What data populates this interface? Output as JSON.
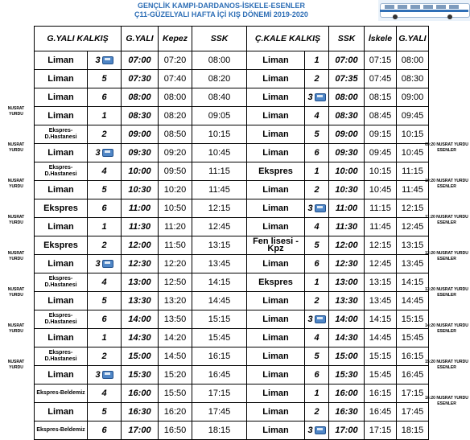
{
  "title": {
    "line1": "GENÇLİK KAMPI-DARDANOS-İSKELE-ESENLER",
    "line2": "Ç11-GÜZELYALI HAFTA İÇİ KIŞ DÖNEMİ 2019-2020"
  },
  "headers": [
    "G.YALI KALKIŞ",
    "",
    "G.YALI",
    "Kepez",
    "SSK",
    "Ç.KALE KALKIŞ",
    "",
    "SSK",
    "İskele",
    "G.YALI"
  ],
  "rows": [
    {
      "p1": "Liman",
      "n1": "3",
      "b1": true,
      "d1": "07:00",
      "k": "07:20",
      "s1": "08:00",
      "p2": "Liman",
      "n2": "1",
      "b2": false,
      "d2": "07:00",
      "s2": "07:15",
      "i": "08:00"
    },
    {
      "p1": "Liman",
      "n1": "5",
      "b1": false,
      "d1": "07:30",
      "k": "07:40",
      "s1": "08:20",
      "p2": "Liman",
      "n2": "2",
      "b2": false,
      "d2": "07:35",
      "s2": "07:45",
      "i": "08:30"
    },
    {
      "p1": "Liman",
      "n1": "6",
      "b1": false,
      "d1": "08:00",
      "k": "08:00",
      "s1": "08:40",
      "p2": "Liman",
      "n2": "3",
      "b2": true,
      "d2": "08:00",
      "s2": "08:15",
      "i": "09:00"
    },
    {
      "p1": "Liman",
      "n1": "1",
      "b1": false,
      "d1": "08:30",
      "k": "08:20",
      "s1": "09:05",
      "p2": "Liman",
      "n2": "4",
      "b2": false,
      "d2": "08:30",
      "s2": "08:45",
      "i": "09:45"
    },
    {
      "p1": "Ekspres-D.Hastanesi",
      "n1": "2",
      "b1": false,
      "d1": "09:00",
      "k": "08:50",
      "s1": "10:15",
      "p2": "Liman",
      "n2": "5",
      "b2": false,
      "d2": "09:00",
      "s2": "09:15",
      "i": "10:15"
    },
    {
      "p1": "Liman",
      "n1": "3",
      "b1": true,
      "d1": "09:30",
      "k": "09:20",
      "s1": "10:45",
      "p2": "Liman",
      "n2": "6",
      "b2": false,
      "d2": "09:30",
      "s2": "09:45",
      "i": "10:45"
    },
    {
      "p1": "Ekspres-D.Hastanesi",
      "n1": "4",
      "b1": false,
      "d1": "10:00",
      "k": "09:50",
      "s1": "11:15",
      "p2": "Ekspres",
      "n2": "1",
      "b2": false,
      "d2": "10:00",
      "s2": "10:15",
      "i": "11:15"
    },
    {
      "p1": "Liman",
      "n1": "5",
      "b1": false,
      "d1": "10:30",
      "k": "10:20",
      "s1": "11:45",
      "p2": "Liman",
      "n2": "2",
      "b2": false,
      "d2": "10:30",
      "s2": "10:45",
      "i": "11:45"
    },
    {
      "p1": "Ekspres",
      "n1": "6",
      "b1": false,
      "d1": "11:00",
      "k": "10:50",
      "s1": "12:15",
      "p2": "Liman",
      "n2": "3",
      "b2": true,
      "d2": "11:00",
      "s2": "11:15",
      "i": "12:15"
    },
    {
      "p1": "Liman",
      "n1": "1",
      "b1": false,
      "d1": "11:30",
      "k": "11:20",
      "s1": "12:45",
      "p2": "Liman",
      "n2": "4",
      "b2": false,
      "d2": "11:30",
      "s2": "11:45",
      "i": "12:45"
    },
    {
      "p1": "Ekspres",
      "n1": "2",
      "b1": false,
      "d1": "12:00",
      "k": "11:50",
      "s1": "13:15",
      "p2": "Fen lisesi - Kpz",
      "n2": "5",
      "b2": false,
      "d2": "12:00",
      "s2": "12:15",
      "i": "13:15"
    },
    {
      "p1": "Liman",
      "n1": "3",
      "b1": true,
      "d1": "12:30",
      "k": "12:20",
      "s1": "13:45",
      "p2": "Liman",
      "n2": "6",
      "b2": false,
      "d2": "12:30",
      "s2": "12:45",
      "i": "13:45"
    },
    {
      "p1": "Ekspres-D.Hastanesi",
      "n1": "4",
      "b1": false,
      "d1": "13:00",
      "k": "12:50",
      "s1": "14:15",
      "p2": "Ekspres",
      "n2": "1",
      "b2": false,
      "d2": "13:00",
      "s2": "13:15",
      "i": "14:15"
    },
    {
      "p1": "Liman",
      "n1": "5",
      "b1": false,
      "d1": "13:30",
      "k": "13:20",
      "s1": "14:45",
      "p2": "Liman",
      "n2": "2",
      "b2": false,
      "d2": "13:30",
      "s2": "13:45",
      "i": "14:45"
    },
    {
      "p1": "Ekspres-D.Hastanesi",
      "n1": "6",
      "b1": false,
      "d1": "14:00",
      "k": "13:50",
      "s1": "15:15",
      "p2": "Liman",
      "n2": "3",
      "b2": true,
      "d2": "14:00",
      "s2": "14:15",
      "i": "15:15"
    },
    {
      "p1": "Liman",
      "n1": "1",
      "b1": false,
      "d1": "14:30",
      "k": "14:20",
      "s1": "15:45",
      "p2": "Liman",
      "n2": "4",
      "b2": false,
      "d2": "14:30",
      "s2": "14:45",
      "i": "15:45"
    },
    {
      "p1": "Ekspres-D.Hastanesi",
      "n1": "2",
      "b1": false,
      "d1": "15:00",
      "k": "14:50",
      "s1": "16:15",
      "p2": "Liman",
      "n2": "5",
      "b2": false,
      "d2": "15:00",
      "s2": "15:15",
      "i": "16:15"
    },
    {
      "p1": "Liman",
      "n1": "3",
      "b1": true,
      "d1": "15:30",
      "k": "15:20",
      "s1": "16:45",
      "p2": "Liman",
      "n2": "6",
      "b2": false,
      "d2": "15:30",
      "s2": "15:45",
      "i": "16:45"
    },
    {
      "p1": "Ekspres-Beldemiz",
      "n1": "4",
      "b1": false,
      "d1": "16:00",
      "k": "15:50",
      "s1": "17:15",
      "p2": "Liman",
      "n2": "1",
      "b2": false,
      "d2": "16:00",
      "s2": "16:15",
      "i": "17:15"
    },
    {
      "p1": "Liman",
      "n1": "5",
      "b1": false,
      "d1": "16:30",
      "k": "16:20",
      "s1": "17:45",
      "p2": "Liman",
      "n2": "2",
      "b2": false,
      "d2": "16:30",
      "s2": "16:45",
      "i": "17:45"
    },
    {
      "p1": "Ekspres-Beldemiz",
      "n1": "6",
      "b1": false,
      "d1": "17:00",
      "k": "16:50",
      "s1": "18:15",
      "p2": "Liman",
      "n2": "3",
      "b2": true,
      "d2": "17:00",
      "s2": "17:15",
      "i": "18:15"
    }
  ],
  "left_notes": [
    {
      "row": 3,
      "text": "NUSRAT YURDU"
    },
    {
      "row": 5,
      "text": "NUSRAT YURDU"
    },
    {
      "row": 7,
      "text": "NUSRAT YURDU"
    },
    {
      "row": 9,
      "text": "NUSRAT YURDU"
    },
    {
      "row": 11,
      "text": "NUSRAT YURDU"
    },
    {
      "row": 13,
      "text": "NUSRAT YURDU"
    },
    {
      "row": 15,
      "text": "NUSRAT YURDU"
    },
    {
      "row": 17,
      "text": "NUSRAT YURDU"
    }
  ],
  "right_notes": [
    {
      "row": 5,
      "text": "09:20 NUSRAT YURDU ESENLER"
    },
    {
      "row": 7,
      "text": "10:20 NUSRAT YURDU ESENLER"
    },
    {
      "row": 9,
      "text": "11:20 NUSRAT YURDU ESENLER"
    },
    {
      "row": 11,
      "text": "12:20 NUSRAT YURDU ESENLER"
    },
    {
      "row": 13,
      "text": "13:20 NUSRAT YURDU ESENLER"
    },
    {
      "row": 15,
      "text": "14:20 NUSRAT YURDU ESENLER"
    },
    {
      "row": 17,
      "text": "15:20 NUSRAT YURDU ESENLER"
    },
    {
      "row": 19,
      "text": "16:20 NUSRAT YURDU ESENLER"
    }
  ],
  "colors": {
    "title": "#2f6fb6",
    "bus_icon": "#4f86c6"
  }
}
